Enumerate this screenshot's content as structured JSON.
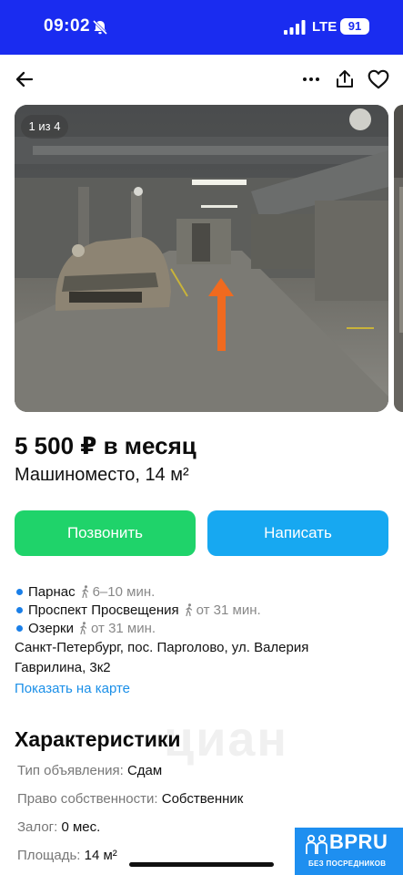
{
  "status_bar": {
    "time": "09:02",
    "network": "LTE",
    "battery": "91",
    "bell_icon": "bell-slash-icon",
    "signal_icon": "cellular-signal-icon"
  },
  "topbar": {
    "back_icon": "arrow-left-icon",
    "more_icon": "more-dots-icon",
    "share_icon": "share-icon",
    "favorite_icon": "heart-icon"
  },
  "gallery": {
    "counter": "1 из 4"
  },
  "listing": {
    "price": "5 500 ₽ в месяц",
    "title": "Машиноместо, 14 м²"
  },
  "actions": {
    "call_label": "Позвонить",
    "message_label": "Написать",
    "call_color": "#1fd36a",
    "message_color": "#17a8f1"
  },
  "metro": [
    {
      "name": "Парнас",
      "time": "6–10 мин."
    },
    {
      "name": "Проспект Просвещения",
      "time": "от 31 мин."
    },
    {
      "name": "Озерки",
      "time": "от 31 мин."
    }
  ],
  "address": "Санкт-Петербург, пос. Парголово, ул. Валерия Гаврилина, 3к2",
  "map_link": "Показать на карте",
  "characteristics": {
    "title": "Характеристики",
    "rows": [
      {
        "key": "Тип объявления:",
        "value": "Сдам"
      },
      {
        "key": "Право собственности:",
        "value": "Собственник"
      },
      {
        "key": "Залог:",
        "value": "0 мес."
      },
      {
        "key": "Площадь:",
        "value": "14 м²"
      }
    ]
  },
  "watermark": "циан",
  "badge": {
    "title": "BPRU",
    "subtitle": "БЕЗ ПОСРЕДНИКОВ",
    "color": "#1e8ff0"
  }
}
